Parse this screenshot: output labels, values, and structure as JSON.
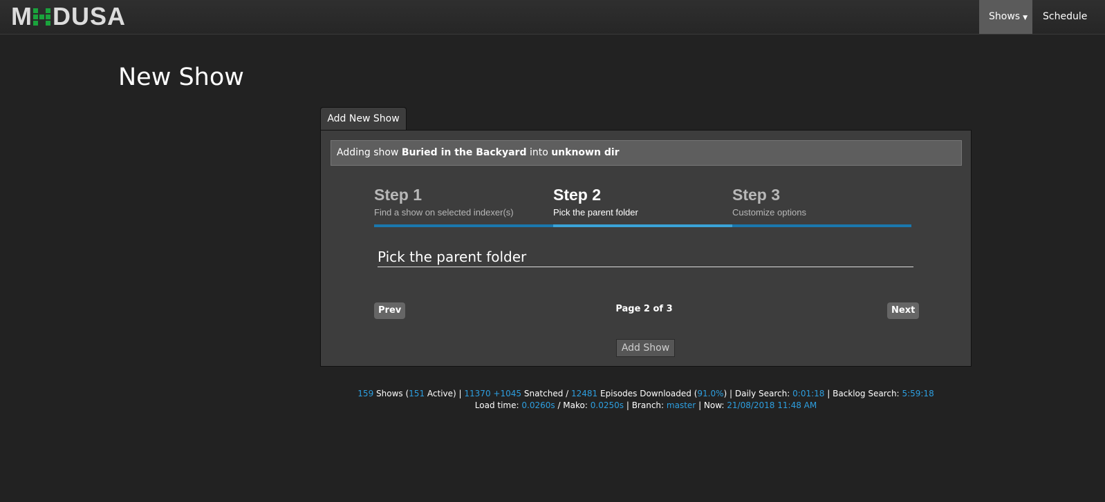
{
  "navbar": {
    "logo_text": "MEDUSA",
    "logo_left": "M",
    "logo_right": "DUSA",
    "shows_label": "Shows",
    "schedule_label": "Schedule",
    "accent_color": "#1aa33c"
  },
  "page": {
    "title": "New Show"
  },
  "tab": {
    "label": "Add New Show"
  },
  "adding": {
    "prefix": "Adding show",
    "show_name": "Buried in the Backyard",
    "middle": "into",
    "dir": "unknown dir"
  },
  "steps": [
    {
      "title": "Step 1",
      "desc": "Find a show on selected indexer(s)"
    },
    {
      "title": "Step 2",
      "desc": "Pick the parent folder"
    },
    {
      "title": "Step 3",
      "desc": "Customize options"
    }
  ],
  "active_step": 2,
  "section": {
    "title": "Pick the parent folder"
  },
  "pager": {
    "prev_label": "Prev",
    "next_label": "Next",
    "indicator": "Page 2 of 3"
  },
  "add_show_button": "Add Show",
  "footer": {
    "shows_count": "159",
    "shows_label": "Shows (",
    "active_count": "151",
    "active_label": "Active) |",
    "snatched_count": "11370",
    "snatched_delta": "+1045",
    "snatched_label": "Snatched  /",
    "episodes_count": "12481",
    "episodes_label": "Episodes Downloaded (",
    "episodes_pct": "91.0%",
    "daily_label": ") | Daily Search:",
    "daily_time": "0:01:18",
    "backlog_label": "| Backlog Search:",
    "backlog_time": "5:59:18",
    "load_label": "Load time:",
    "load_time": "0.0260s",
    "mako_label": "/ Mako:",
    "mako_time": "0.0250s",
    "branch_label": "| Branch:",
    "branch": "master",
    "now_label": "| Now:",
    "now": "21/08/2018 11:48 AM",
    "link_color": "#2d9fe0"
  }
}
